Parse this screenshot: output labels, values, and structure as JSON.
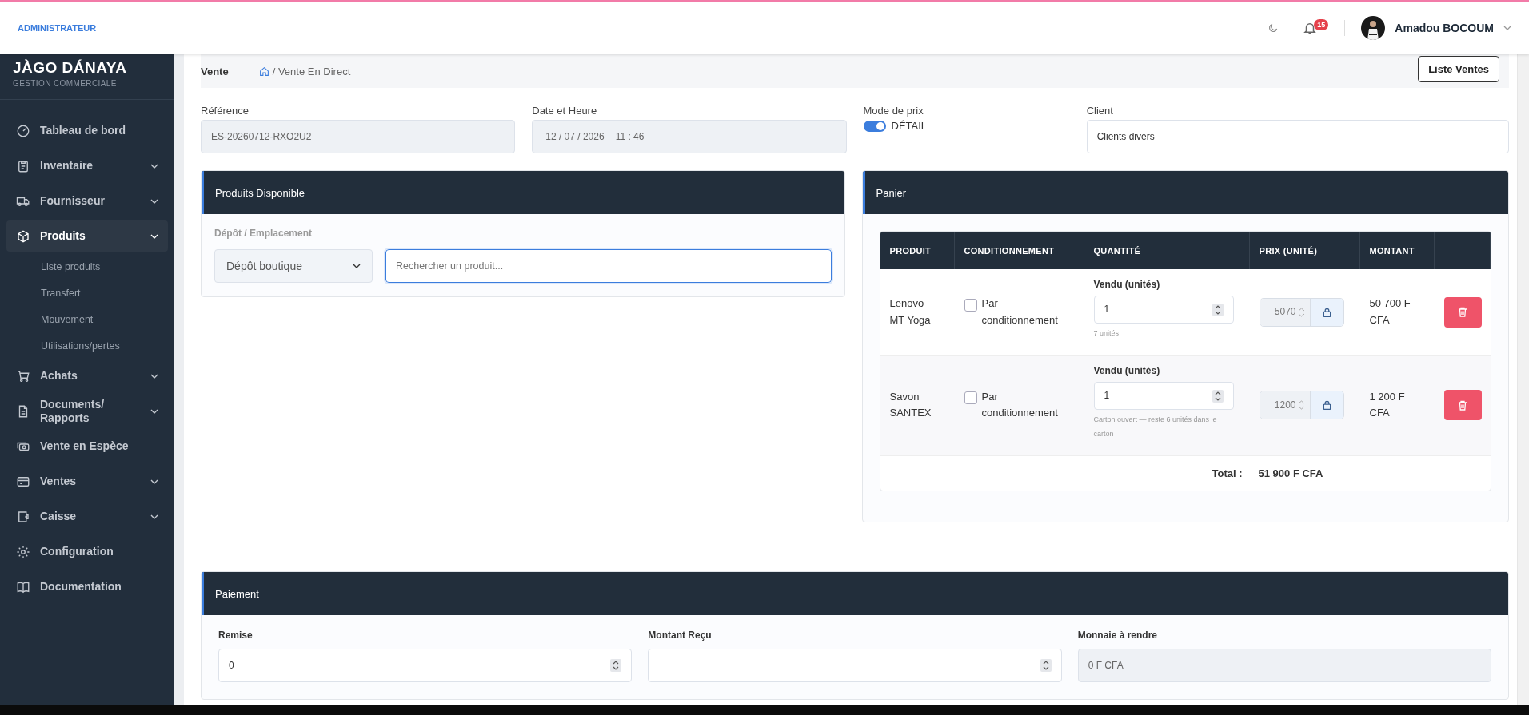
{
  "header": {
    "role": "ADMINISTRATEUR",
    "notifications": "15",
    "user_name": "Amadou BOCOUM"
  },
  "sidebar": {
    "brand": "JÀGO DÁNAYA",
    "subtitle": "GESTION COMMERCIALE",
    "items": [
      {
        "label": "Tableau de bord",
        "has_submenu": false,
        "selected": false
      },
      {
        "label": "Inventaire",
        "has_submenu": true,
        "selected": false
      },
      {
        "label": "Fournisseur",
        "has_submenu": true,
        "selected": false
      },
      {
        "label": "Produits",
        "has_submenu": true,
        "selected": true,
        "children": [
          {
            "label": "Liste produits"
          },
          {
            "label": "Transfert"
          },
          {
            "label": "Mouvement"
          },
          {
            "label": "Utilisations/pertes"
          }
        ]
      },
      {
        "label": "Achats",
        "has_submenu": true,
        "selected": false
      },
      {
        "label": "Documents/ Rapports",
        "has_submenu": true,
        "selected": false
      },
      {
        "label": "Vente en Espèce",
        "has_submenu": false,
        "selected": false
      },
      {
        "label": "Ventes",
        "has_submenu": true,
        "selected": false
      },
      {
        "label": "Caisse",
        "has_submenu": true,
        "selected": false
      },
      {
        "label": "Configuration",
        "has_submenu": false,
        "selected": false
      },
      {
        "label": "Documentation",
        "has_submenu": false,
        "selected": false
      }
    ]
  },
  "breadcrumb": {
    "title": "Vente",
    "path": "/ Vente En Direct",
    "button": "Liste Ventes"
  },
  "form": {
    "reference": {
      "label": "Référence",
      "value": "ES-20260712-RXO2U2"
    },
    "datetime": {
      "label": "Date et Heure",
      "date": "12 / 07 / 2026",
      "time": "11 : 46"
    },
    "price_mode": {
      "label": "Mode de prix",
      "on": true,
      "value": "DÉTAIL"
    },
    "client": {
      "label": "Client",
      "value": "Clients divers"
    }
  },
  "products_panel": {
    "title": "Produits Disponible",
    "depot_label": "Dépôt / Emplacement",
    "depot_value": "Dépôt boutique",
    "search_placeholder": "Rechercher un produit..."
  },
  "cart": {
    "title": "Panier",
    "columns": [
      "PRODUIT",
      "CONDITIONNEMENT",
      "QUANTITÉ",
      "PRIX (UNITÉ)",
      "MONTANT"
    ],
    "rows": [
      {
        "product": "Lenovo MT Yoga",
        "packaging_label": "Par conditionnement",
        "packaging_checked": false,
        "qty_label": "Vendu (unités)",
        "qty": "1",
        "qty_hint": "7 unités",
        "price": "5070",
        "amount": "50 700 F CFA"
      },
      {
        "product": "Savon SANTEX",
        "packaging_label": "Par conditionnement",
        "packaging_checked": false,
        "qty_label": "Vendu (unités)",
        "qty": "1",
        "qty_hint": "Carton ouvert — reste 6 unités dans le carton",
        "price": "1200",
        "amount": "1 200 F CFA"
      }
    ],
    "total_label": "Total :",
    "total_value": "51 900 F CFA"
  },
  "payment": {
    "title": "Paiement",
    "fields": [
      {
        "label": "Remise",
        "kind": "number",
        "value": "0"
      },
      {
        "label": "Montant Reçu",
        "kind": "number"
      },
      {
        "label": "Monnaie à rendre",
        "kind": "readonly",
        "value": "0 F CFA"
      }
    ]
  }
}
